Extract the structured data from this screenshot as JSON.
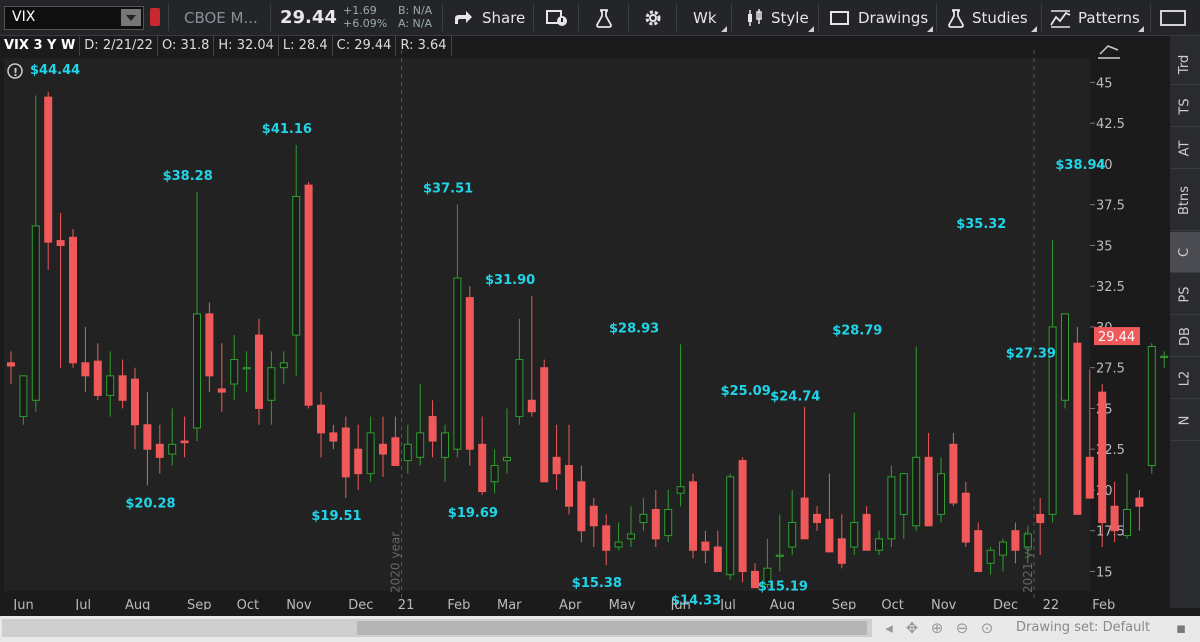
{
  "toolbar": {
    "symbol": "VIX",
    "exchange": "CBOE M...",
    "last": "29.44",
    "change": "+1.69",
    "change_pct": "+6.09%",
    "bid": "B: N/A",
    "ask": "A: N/A",
    "share": "Share",
    "period": "Wk",
    "style": "Style",
    "drawings": "Drawings",
    "studies": "Studies",
    "patterns": "Patterns"
  },
  "info": {
    "symbol_period": "VIX 3 Y W",
    "date": "D: 2/21/22",
    "open": "O: 31.8",
    "high": "H: 32.04",
    "low": "L: 28.4",
    "close": "C: 29.44",
    "range": "R: 3.64"
  },
  "sidebar": [
    "Trd",
    "TS",
    "AT",
    "Btns",
    "C",
    "PS",
    "DB",
    "L2",
    "N"
  ],
  "bottom": {
    "drawing_set": "Drawing set: Default"
  },
  "colors": {
    "up": "#2f9e2f",
    "down": "#f0595a",
    "label": "#21d4e8",
    "price_tag": "#f0595a"
  },
  "chart_data": {
    "type": "candlestick",
    "y_ticks": [
      "45",
      "42.5",
      "40",
      "37.5",
      "35",
      "32.5",
      "30",
      "27.5",
      "25",
      "22.5",
      "20",
      "17.5",
      "15"
    ],
    "x_labels": [
      {
        "label": "Jun",
        "i": 1
      },
      {
        "label": "Jul",
        "i": 6
      },
      {
        "label": "Aug",
        "i": 10
      },
      {
        "label": "Sep",
        "i": 15
      },
      {
        "label": "Oct",
        "i": 19
      },
      {
        "label": "Nov",
        "i": 23
      },
      {
        "label": "Dec",
        "i": 28
      },
      {
        "label": "21",
        "i": 32
      },
      {
        "label": "Feb",
        "i": 36
      },
      {
        "label": "Mar",
        "i": 40
      },
      {
        "label": "Apr",
        "i": 45
      },
      {
        "label": "May",
        "i": 49
      },
      {
        "label": "Jun",
        "i": 54
      },
      {
        "label": "Jul",
        "i": 58
      },
      {
        "label": "Aug",
        "i": 62
      },
      {
        "label": "Sep",
        "i": 67
      },
      {
        "label": "Oct",
        "i": 71
      },
      {
        "label": "Nov",
        "i": 75
      },
      {
        "label": "Dec",
        "i": 80
      },
      {
        "label": "22",
        "i": 84
      },
      {
        "label": "Feb",
        "i": 88
      }
    ],
    "year_markers": [
      {
        "label": "2020 year",
        "i": 31.5
      },
      {
        "label": "2021 year",
        "i": 82.5
      }
    ],
    "price_tag": "29.44",
    "annotations": [
      {
        "text": "$44.44",
        "i": 3,
        "pos": "corner"
      },
      {
        "text": "$20.28",
        "i": 11,
        "pos": "below",
        "low": 20.28
      },
      {
        "text": "$38.28",
        "i": 14,
        "pos": "above",
        "high": 38.28
      },
      {
        "text": "$41.16",
        "i": 22,
        "pos": "above",
        "high": 41.16
      },
      {
        "text": "$19.51",
        "i": 26,
        "pos": "below",
        "low": 19.51
      },
      {
        "text": "$37.51",
        "i": 35,
        "pos": "above",
        "high": 37.51
      },
      {
        "text": "$19.69",
        "i": 37,
        "pos": "below",
        "low": 19.69
      },
      {
        "text": "$31.90",
        "i": 40,
        "pos": "above",
        "high": 31.9
      },
      {
        "text": "$15.38",
        "i": 47,
        "pos": "below",
        "low": 15.38
      },
      {
        "text": "$28.93",
        "i": 50,
        "pos": "above",
        "high": 28.93
      },
      {
        "text": "$14.33",
        "i": 55,
        "pos": "below",
        "low": 14.33
      },
      {
        "text": "$25.09",
        "i": 59,
        "pos": "above",
        "high": 25.09
      },
      {
        "text": "$24.74",
        "i": 63,
        "pos": "above",
        "high": 24.74
      },
      {
        "text": "$15.19",
        "i": 62,
        "pos": "below",
        "low": 15.19
      },
      {
        "text": "$28.79",
        "i": 68,
        "pos": "above",
        "high": 28.79
      },
      {
        "text": "$35.32",
        "i": 78,
        "pos": "above",
        "high": 35.32
      },
      {
        "text": "$27.39",
        "i": 82,
        "pos": "above",
        "high": 27.39
      },
      {
        "text": "$38.94",
        "i": 86,
        "pos": "above",
        "high": 38.94
      }
    ],
    "candles": [
      [
        27.8,
        28.5,
        26.5,
        27.6
      ],
      [
        24.5,
        27.0,
        24.0,
        27.0
      ],
      [
        25.5,
        44.2,
        24.8,
        36.2
      ],
      [
        44.1,
        44.44,
        33.5,
        35.2
      ],
      [
        35.3,
        37.0,
        27.5,
        35.0
      ],
      [
        35.5,
        36.0,
        27.5,
        27.8
      ],
      [
        27.8,
        30.0,
        26.0,
        27.0
      ],
      [
        27.9,
        29.0,
        25.5,
        25.8
      ],
      [
        25.8,
        28.5,
        24.5,
        27.0
      ],
      [
        27.0,
        28.0,
        25.0,
        25.5
      ],
      [
        26.8,
        27.5,
        22.5,
        24.0
      ],
      [
        24.0,
        26.0,
        20.28,
        22.5
      ],
      [
        22.8,
        24.0,
        21.0,
        22.0
      ],
      [
        22.2,
        25.0,
        21.5,
        22.8
      ],
      [
        23.0,
        24.5,
        22.0,
        22.9
      ],
      [
        23.8,
        38.28,
        23.0,
        30.8
      ],
      [
        30.8,
        31.5,
        26.0,
        27.0
      ],
      [
        26.2,
        29.0,
        24.8,
        26.0
      ],
      [
        26.5,
        29.5,
        25.5,
        28.0
      ],
      [
        27.5,
        28.5,
        26.0,
        27.5
      ],
      [
        29.5,
        30.5,
        24.0,
        25.0
      ],
      [
        25.5,
        28.5,
        24.0,
        27.5
      ],
      [
        27.5,
        28.5,
        26.5,
        27.8
      ],
      [
        29.5,
        41.16,
        27.0,
        38.0
      ],
      [
        38.7,
        38.9,
        25.0,
        25.2
      ],
      [
        25.2,
        26.0,
        22.0,
        23.5
      ],
      [
        23.5,
        24.0,
        22.5,
        23.0
      ],
      [
        23.8,
        24.5,
        19.51,
        20.8
      ],
      [
        22.5,
        24.0,
        20.0,
        21.0
      ],
      [
        21.0,
        24.5,
        20.5,
        23.5
      ],
      [
        22.8,
        24.5,
        20.8,
        22.2
      ],
      [
        23.2,
        24.5,
        21.5,
        21.5
      ],
      [
        21.8,
        24.0,
        21.0,
        22.8
      ],
      [
        22.0,
        26.5,
        21.5,
        23.5
      ],
      [
        24.5,
        25.5,
        22.0,
        23.0
      ],
      [
        22.0,
        24.0,
        20.5,
        23.5
      ],
      [
        22.5,
        37.51,
        22.0,
        33.0
      ],
      [
        31.8,
        32.5,
        21.5,
        22.5
      ],
      [
        22.8,
        24.5,
        19.69,
        19.9
      ],
      [
        20.5,
        22.5,
        19.8,
        21.5
      ],
      [
        21.8,
        25.0,
        21.0,
        22.0
      ],
      [
        24.5,
        30.5,
        24.0,
        28.0
      ],
      [
        25.5,
        31.9,
        24.5,
        24.8
      ],
      [
        27.5,
        28.0,
        20.5,
        20.5
      ],
      [
        22.0,
        24.0,
        20.0,
        21.0
      ],
      [
        21.5,
        24.0,
        18.5,
        19.0
      ],
      [
        20.5,
        21.5,
        16.8,
        17.5
      ],
      [
        19.0,
        19.5,
        16.5,
        17.8
      ],
      [
        17.8,
        18.5,
        15.38,
        16.3
      ],
      [
        16.5,
        18.0,
        16.3,
        16.8
      ],
      [
        17.0,
        19.0,
        16.5,
        17.3
      ],
      [
        18.0,
        19.5,
        17.5,
        18.5
      ],
      [
        18.8,
        20.0,
        16.5,
        17.0
      ],
      [
        17.2,
        20.0,
        16.8,
        18.8
      ],
      [
        19.8,
        28.93,
        19.0,
        20.2
      ],
      [
        20.5,
        21.0,
        15.8,
        16.3
      ],
      [
        16.8,
        17.5,
        15.5,
        16.3
      ],
      [
        16.5,
        17.5,
        15.0,
        15.0
      ],
      [
        14.8,
        21.0,
        14.5,
        20.8
      ],
      [
        21.8,
        22.0,
        14.33,
        15.0
      ],
      [
        15.0,
        15.5,
        14.33,
        14.0
      ],
      [
        14.2,
        17.0,
        14.0,
        15.2
      ],
      [
        16.0,
        18.5,
        15.0,
        16.0
      ],
      [
        16.5,
        20.0,
        16.0,
        18.0
      ],
      [
        19.5,
        25.09,
        17.0,
        17.0
      ],
      [
        18.5,
        19.0,
        17.5,
        18.0
      ],
      [
        18.2,
        21.0,
        16.5,
        16.2
      ],
      [
        17.0,
        18.5,
        15.19,
        15.5
      ],
      [
        16.5,
        24.74,
        16.0,
        18.0
      ],
      [
        18.5,
        19.0,
        16.5,
        16.3
      ],
      [
        16.3,
        17.5,
        16.0,
        17.0
      ],
      [
        17.0,
        21.5,
        16.5,
        20.8
      ],
      [
        18.5,
        21.0,
        17.0,
        21.0
      ],
      [
        17.8,
        28.79,
        17.5,
        22.0
      ],
      [
        22.0,
        23.5,
        19.0,
        17.8
      ],
      [
        18.5,
        22.0,
        18.0,
        21.0
      ],
      [
        22.8,
        23.5,
        19.0,
        19.2
      ],
      [
        19.8,
        20.5,
        16.5,
        16.8
      ],
      [
        17.5,
        18.0,
        15.2,
        15.0
      ],
      [
        15.5,
        16.5,
        14.8,
        16.3
      ],
      [
        16.0,
        17.0,
        15.0,
        16.8
      ],
      [
        17.5,
        18.0,
        15.5,
        16.3
      ],
      [
        16.5,
        17.8,
        15.5,
        17.3
      ],
      [
        18.5,
        19.5,
        16.0,
        18.0
      ],
      [
        18.5,
        35.32,
        18.0,
        30.0
      ],
      [
        25.5,
        30.8,
        25.0,
        30.8
      ],
      [
        29.0,
        30.0,
        18.5,
        18.5
      ],
      [
        22.0,
        27.39,
        19.5,
        19.5
      ],
      [
        26.0,
        26.5,
        16.5,
        18.0
      ],
      [
        19.0,
        20.5,
        16.8,
        17.5
      ],
      [
        17.2,
        21.0,
        17.0,
        18.8
      ],
      [
        19.5,
        20.0,
        17.5,
        19.0
      ],
      [
        21.5,
        29.0,
        21.0,
        28.8
      ],
      [
        28.2,
        28.5,
        27.5,
        28.2
      ],
      [
        27.0,
        38.94,
        22.0,
        23.5
      ],
      [
        24.0,
        28.5,
        20.0,
        24.0
      ],
      [
        24.5,
        28.5,
        24.0,
        27.5
      ],
      [
        28.0,
        31.0,
        24.0,
        29.5
      ],
      [
        31.8,
        32.04,
        28.4,
        29.44
      ]
    ]
  }
}
